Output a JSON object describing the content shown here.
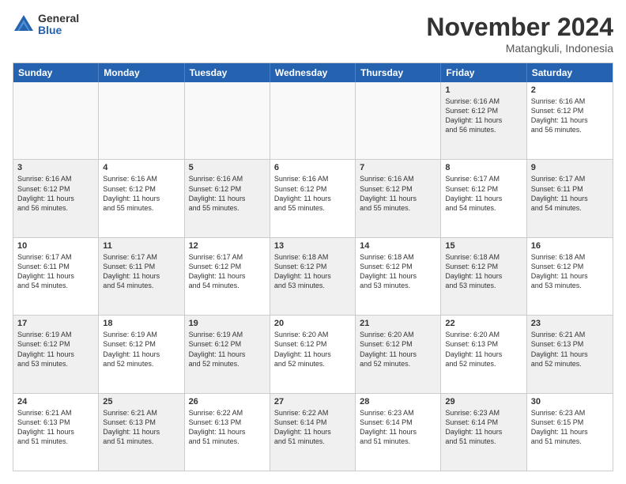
{
  "logo": {
    "general": "General",
    "blue": "Blue"
  },
  "header": {
    "month": "November 2024",
    "location": "Matangkuli, Indonesia"
  },
  "days": [
    "Sunday",
    "Monday",
    "Tuesday",
    "Wednesday",
    "Thursday",
    "Friday",
    "Saturday"
  ],
  "rows": [
    [
      {
        "day": "",
        "text": "",
        "empty": true
      },
      {
        "day": "",
        "text": "",
        "empty": true
      },
      {
        "day": "",
        "text": "",
        "empty": true
      },
      {
        "day": "",
        "text": "",
        "empty": true
      },
      {
        "day": "",
        "text": "",
        "empty": true
      },
      {
        "day": "1",
        "text": "Sunrise: 6:16 AM\nSunset: 6:12 PM\nDaylight: 11 hours\nand 56 minutes.",
        "shaded": true
      },
      {
        "day": "2",
        "text": "Sunrise: 6:16 AM\nSunset: 6:12 PM\nDaylight: 11 hours\nand 56 minutes.",
        "shaded": false
      }
    ],
    [
      {
        "day": "3",
        "text": "Sunrise: 6:16 AM\nSunset: 6:12 PM\nDaylight: 11 hours\nand 56 minutes.",
        "shaded": true
      },
      {
        "day": "4",
        "text": "Sunrise: 6:16 AM\nSunset: 6:12 PM\nDaylight: 11 hours\nand 55 minutes.",
        "shaded": false
      },
      {
        "day": "5",
        "text": "Sunrise: 6:16 AM\nSunset: 6:12 PM\nDaylight: 11 hours\nand 55 minutes.",
        "shaded": true
      },
      {
        "day": "6",
        "text": "Sunrise: 6:16 AM\nSunset: 6:12 PM\nDaylight: 11 hours\nand 55 minutes.",
        "shaded": false
      },
      {
        "day": "7",
        "text": "Sunrise: 6:16 AM\nSunset: 6:12 PM\nDaylight: 11 hours\nand 55 minutes.",
        "shaded": true
      },
      {
        "day": "8",
        "text": "Sunrise: 6:17 AM\nSunset: 6:12 PM\nDaylight: 11 hours\nand 54 minutes.",
        "shaded": false
      },
      {
        "day": "9",
        "text": "Sunrise: 6:17 AM\nSunset: 6:11 PM\nDaylight: 11 hours\nand 54 minutes.",
        "shaded": true
      }
    ],
    [
      {
        "day": "10",
        "text": "Sunrise: 6:17 AM\nSunset: 6:11 PM\nDaylight: 11 hours\nand 54 minutes.",
        "shaded": false
      },
      {
        "day": "11",
        "text": "Sunrise: 6:17 AM\nSunset: 6:11 PM\nDaylight: 11 hours\nand 54 minutes.",
        "shaded": true
      },
      {
        "day": "12",
        "text": "Sunrise: 6:17 AM\nSunset: 6:12 PM\nDaylight: 11 hours\nand 54 minutes.",
        "shaded": false
      },
      {
        "day": "13",
        "text": "Sunrise: 6:18 AM\nSunset: 6:12 PM\nDaylight: 11 hours\nand 53 minutes.",
        "shaded": true
      },
      {
        "day": "14",
        "text": "Sunrise: 6:18 AM\nSunset: 6:12 PM\nDaylight: 11 hours\nand 53 minutes.",
        "shaded": false
      },
      {
        "day": "15",
        "text": "Sunrise: 6:18 AM\nSunset: 6:12 PM\nDaylight: 11 hours\nand 53 minutes.",
        "shaded": true
      },
      {
        "day": "16",
        "text": "Sunrise: 6:18 AM\nSunset: 6:12 PM\nDaylight: 11 hours\nand 53 minutes.",
        "shaded": false
      }
    ],
    [
      {
        "day": "17",
        "text": "Sunrise: 6:19 AM\nSunset: 6:12 PM\nDaylight: 11 hours\nand 53 minutes.",
        "shaded": true
      },
      {
        "day": "18",
        "text": "Sunrise: 6:19 AM\nSunset: 6:12 PM\nDaylight: 11 hours\nand 52 minutes.",
        "shaded": false
      },
      {
        "day": "19",
        "text": "Sunrise: 6:19 AM\nSunset: 6:12 PM\nDaylight: 11 hours\nand 52 minutes.",
        "shaded": true
      },
      {
        "day": "20",
        "text": "Sunrise: 6:20 AM\nSunset: 6:12 PM\nDaylight: 11 hours\nand 52 minutes.",
        "shaded": false
      },
      {
        "day": "21",
        "text": "Sunrise: 6:20 AM\nSunset: 6:12 PM\nDaylight: 11 hours\nand 52 minutes.",
        "shaded": true
      },
      {
        "day": "22",
        "text": "Sunrise: 6:20 AM\nSunset: 6:13 PM\nDaylight: 11 hours\nand 52 minutes.",
        "shaded": false
      },
      {
        "day": "23",
        "text": "Sunrise: 6:21 AM\nSunset: 6:13 PM\nDaylight: 11 hours\nand 52 minutes.",
        "shaded": true
      }
    ],
    [
      {
        "day": "24",
        "text": "Sunrise: 6:21 AM\nSunset: 6:13 PM\nDaylight: 11 hours\nand 51 minutes.",
        "shaded": false
      },
      {
        "day": "25",
        "text": "Sunrise: 6:21 AM\nSunset: 6:13 PM\nDaylight: 11 hours\nand 51 minutes.",
        "shaded": true
      },
      {
        "day": "26",
        "text": "Sunrise: 6:22 AM\nSunset: 6:13 PM\nDaylight: 11 hours\nand 51 minutes.",
        "shaded": false
      },
      {
        "day": "27",
        "text": "Sunrise: 6:22 AM\nSunset: 6:14 PM\nDaylight: 11 hours\nand 51 minutes.",
        "shaded": true
      },
      {
        "day": "28",
        "text": "Sunrise: 6:23 AM\nSunset: 6:14 PM\nDaylight: 11 hours\nand 51 minutes.",
        "shaded": false
      },
      {
        "day": "29",
        "text": "Sunrise: 6:23 AM\nSunset: 6:14 PM\nDaylight: 11 hours\nand 51 minutes.",
        "shaded": true
      },
      {
        "day": "30",
        "text": "Sunrise: 6:23 AM\nSunset: 6:15 PM\nDaylight: 11 hours\nand 51 minutes.",
        "shaded": false
      }
    ]
  ]
}
